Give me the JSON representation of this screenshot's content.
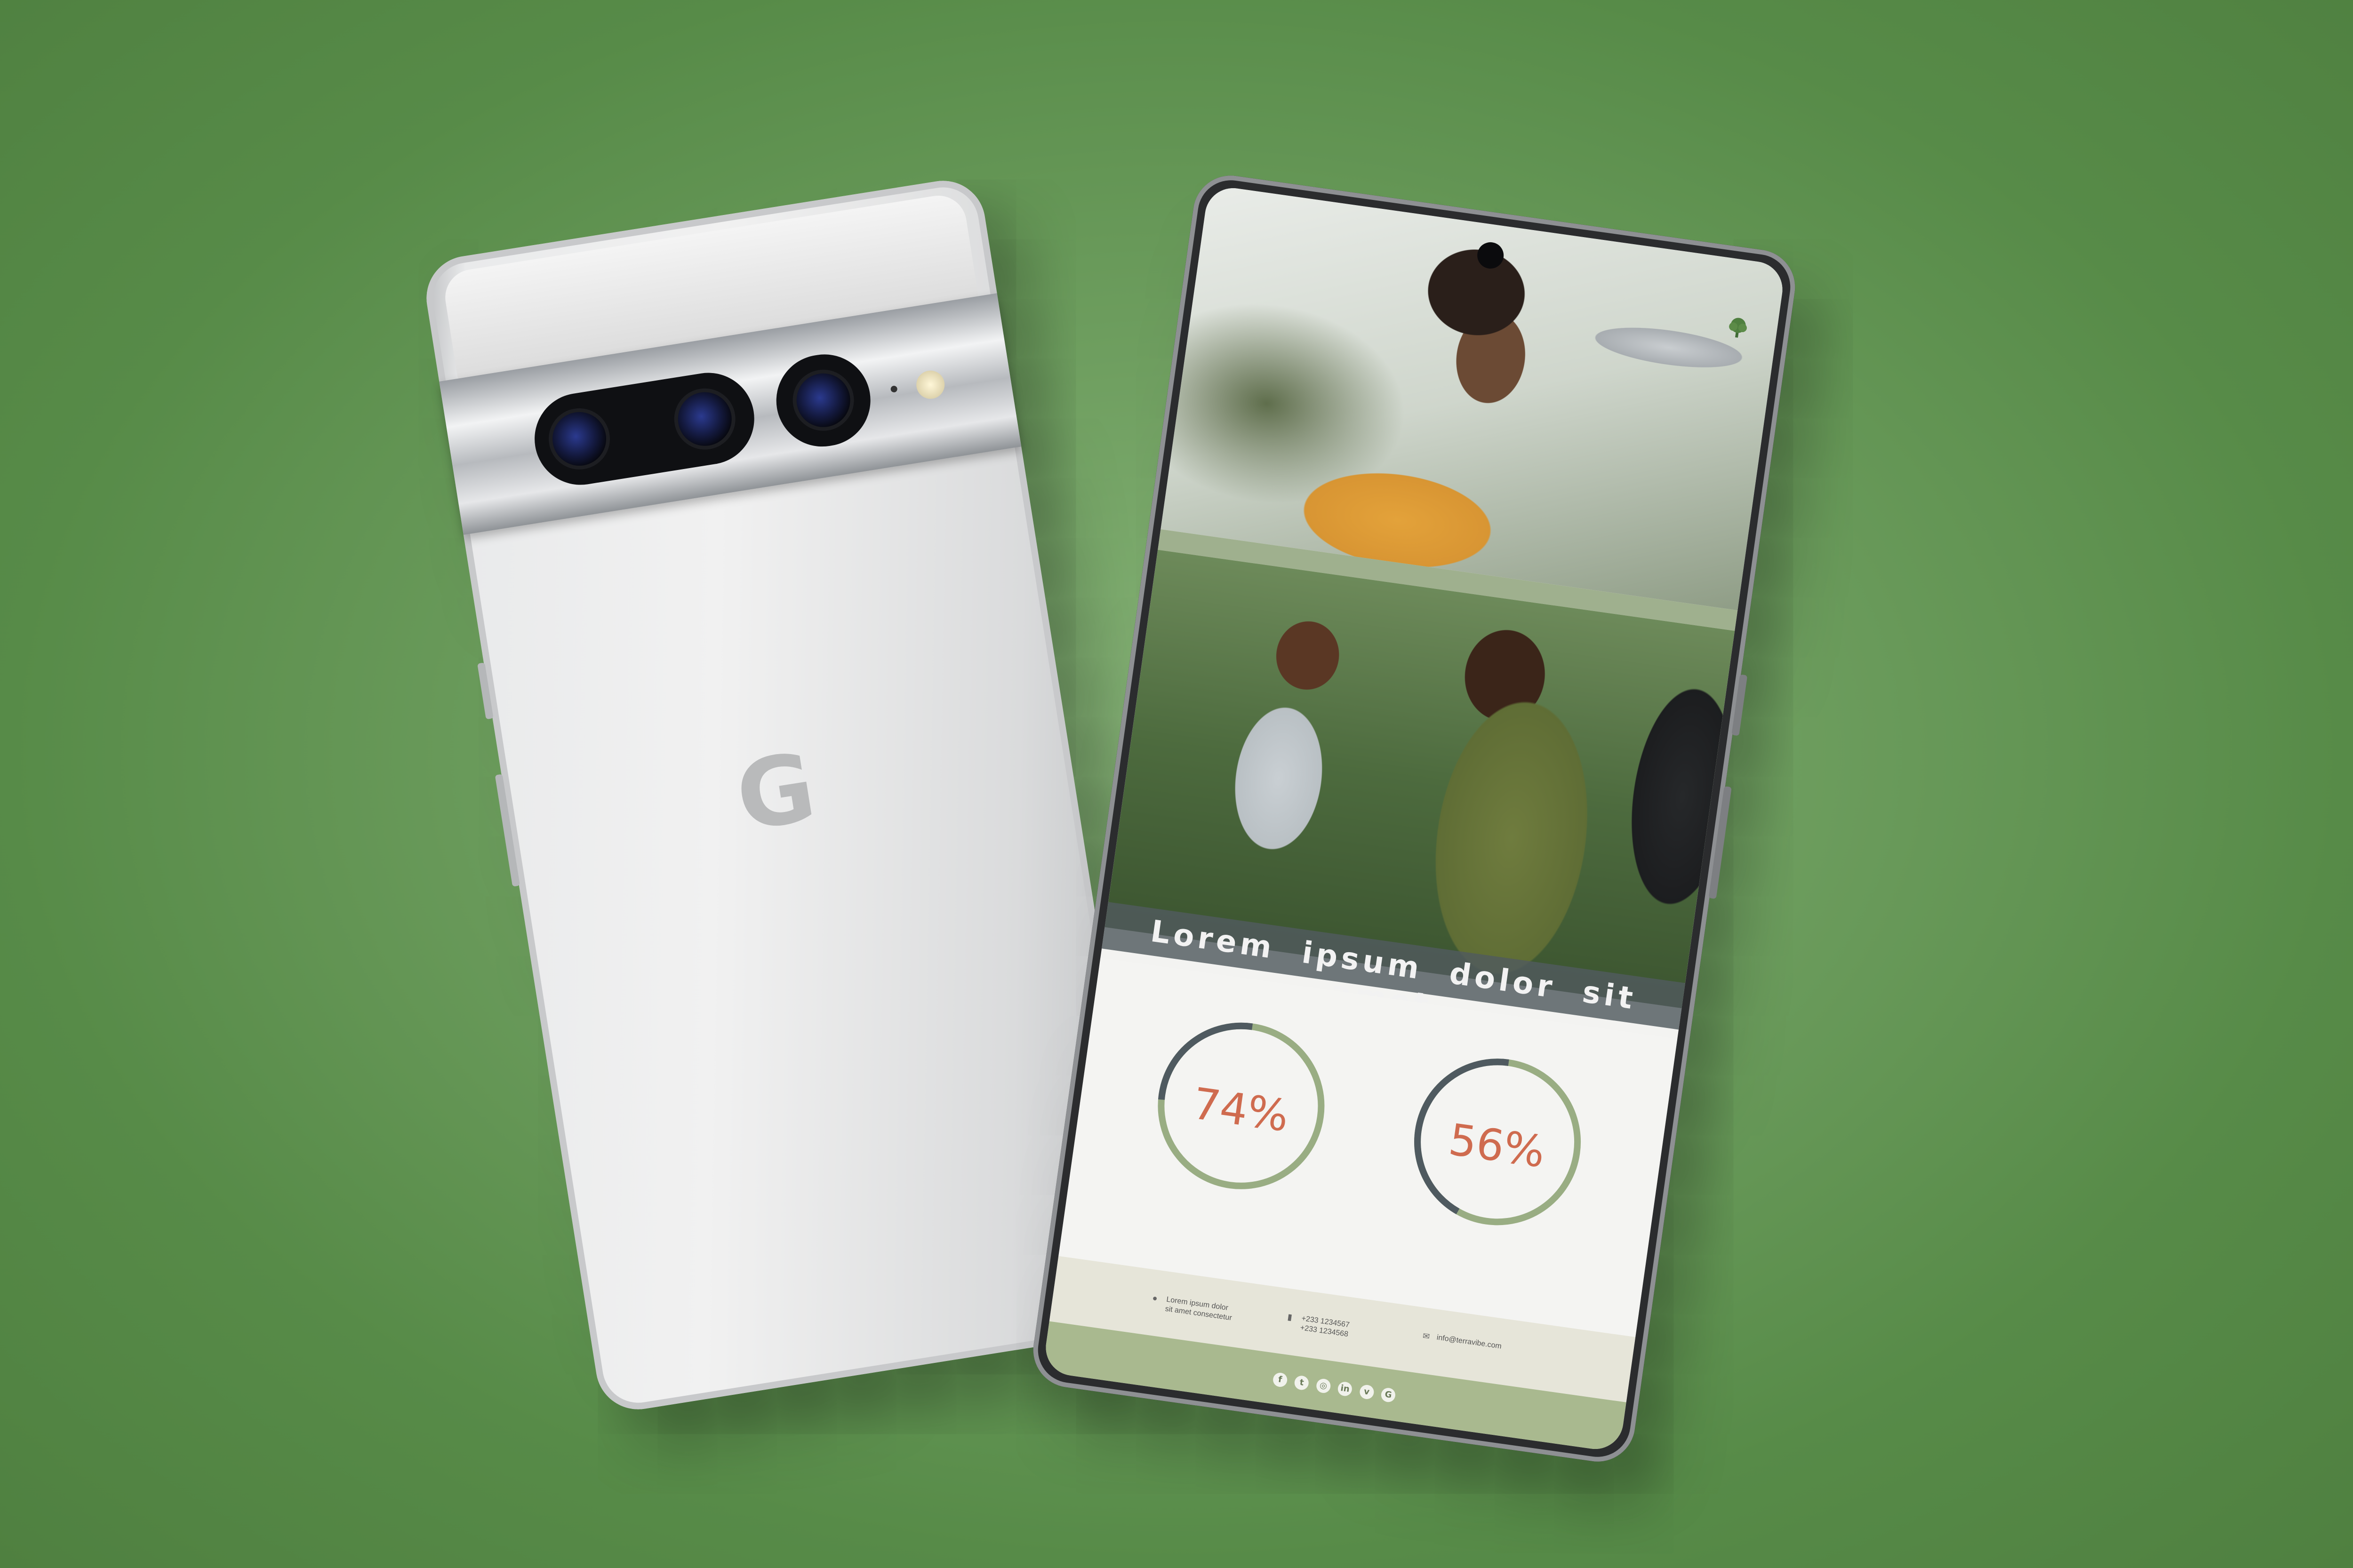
{
  "back_phone": {
    "logo_letter": "G"
  },
  "screen": {
    "headline": "Lorem ipsum dolor sit amet,",
    "stats": [
      {
        "label": "74%",
        "value": 74
      },
      {
        "label": "56%",
        "value": 56
      }
    ],
    "footer": {
      "address_line1": "Lorem ipsum dolor",
      "address_line2": "sit amet consectetur",
      "phone_line1": "+233 1234567",
      "phone_line2": "+233 1234568",
      "email": "info@terravibe.com"
    },
    "social_icons": [
      "facebook-icon",
      "twitter-icon",
      "instagram-icon",
      "linkedin-icon",
      "vine-icon",
      "google-icon"
    ]
  },
  "colors": {
    "background": "#6e9e5f",
    "accent_green": "#9fb08e",
    "percent_text": "#cf6b4f",
    "ring_track": "#99ad83",
    "ring_progress": "#4f5a60"
  }
}
